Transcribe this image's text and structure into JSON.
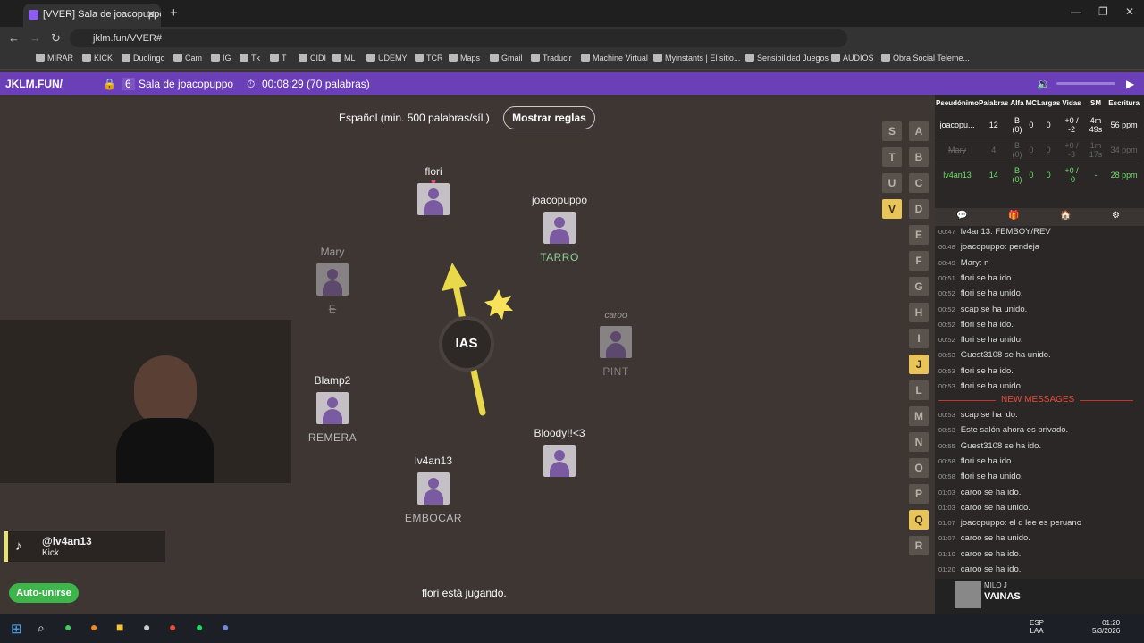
{
  "browser": {
    "tab_title": "[VVER] Sala de joacopuppo",
    "url": "jklm.fun/VVER#",
    "bookmarks": [
      "MIRAR",
      "KICK",
      "Duolingo",
      "Cam",
      "IG",
      "Tk",
      "T",
      "CIDI",
      "ML",
      "UDEMY",
      "TCR",
      "Maps",
      "Gmail",
      "Traducir",
      "Machine Virtual",
      "Myinstants | El sitio...",
      "Sensibilidad Juegos",
      "AUDIOS",
      "Obra Social Teleme..."
    ]
  },
  "header": {
    "site": "JKLM.FUN/",
    "count": "6",
    "room": "Sala de joacopuppo",
    "timer": "00:08:29 (70 palabras)"
  },
  "game": {
    "language": "Español (min. 500 palabras/síl.)",
    "rules_button": "Mostrar reglas",
    "syllable": "IAS",
    "status": "flori está jugando.",
    "autojoin": "Auto-unirse",
    "players": [
      {
        "name": "flori",
        "word": "",
        "hearts": "♥",
        "dead": false
      },
      {
        "name": "joacopuppo",
        "word": "TARRO",
        "hearts": "♥",
        "dead": false
      },
      {
        "name": "Mary",
        "word": "E",
        "hearts": "☠",
        "dead": true
      },
      {
        "name": "caroo",
        "word": "PINT",
        "hearts": "☠",
        "dead": true
      },
      {
        "name": "Blamp2",
        "word": "REMERA",
        "hearts": "♥♥",
        "dead": false
      },
      {
        "name": "Bloody!!<3",
        "word": "",
        "hearts": "☠",
        "dead": true
      },
      {
        "name": "lv4an13",
        "word": "EMBOCAR",
        "hearts": "♥♥♥",
        "dead": false
      }
    ],
    "letters_a": [
      "A",
      "B",
      "C",
      "D",
      "E",
      "F",
      "G",
      "H",
      "I",
      "J",
      "L",
      "M",
      "N",
      "O",
      "P",
      "Q",
      "R"
    ],
    "letters_s": [
      "S",
      "T",
      "U",
      "V"
    ],
    "letters_on": [
      "V",
      "J",
      "Q"
    ]
  },
  "overlay": {
    "handle": "@lv4an13",
    "platform": "Kick"
  },
  "scores": {
    "headers": [
      "Pseudónimo",
      "Palabras",
      "Alfa",
      "MC",
      "Largas",
      "Vidas",
      "SM",
      "Escritura"
    ],
    "rows": [
      [
        "joacopu...",
        "12",
        "B (0)",
        "0",
        "0",
        "+0 / -2",
        "4m 49s",
        "56 ppm"
      ],
      [
        "Mary",
        "4",
        "B (0)",
        "0",
        "0",
        "+0 / -3",
        "1m 17s",
        "34 ppm"
      ],
      [
        "lv4an13",
        "14",
        "B (0)",
        "0",
        "0",
        "+0 / -0",
        "-",
        "28 ppm"
      ]
    ]
  },
  "chat": {
    "messages": [
      {
        "t": "00:47",
        "text": "lv4an13: FEMBOY/REV"
      },
      {
        "t": "00:48",
        "text": "joacopuppo: pendeja"
      },
      {
        "t": "00:49",
        "text": "Mary: n"
      },
      {
        "t": "00:51",
        "text": "flori se ha ido."
      },
      {
        "t": "00:52",
        "text": "flori se ha unido."
      },
      {
        "t": "00:52",
        "text": "scap se ha unido."
      },
      {
        "t": "00:52",
        "text": "flori se ha ido."
      },
      {
        "t": "00:52",
        "text": "flori se ha unido."
      },
      {
        "t": "00:53",
        "text": "Guest3108 se ha unido."
      },
      {
        "t": "00:53",
        "text": "flori se ha ido."
      },
      {
        "t": "00:53",
        "text": "flori se ha unido."
      }
    ],
    "divider": "NEW MESSAGES",
    "new_messages": [
      {
        "t": "00:53",
        "text": "scap se ha ido."
      },
      {
        "t": "00:53",
        "text": "Este salón ahora es privado."
      },
      {
        "t": "00:55",
        "text": "Guest3108 se ha ido."
      },
      {
        "t": "00:58",
        "text": "flori se ha ido."
      },
      {
        "t": "00:58",
        "text": "flori se ha unido."
      },
      {
        "t": "01:03",
        "text": "caroo se ha ido."
      },
      {
        "t": "01:03",
        "text": "caroo se ha unido."
      },
      {
        "t": "01:07",
        "text": "joacopuppo: el q lee es peruano"
      },
      {
        "t": "01:07",
        "text": "caroo se ha unido."
      },
      {
        "t": "01:10",
        "text": "caroo se ha ido."
      },
      {
        "t": "01:20",
        "text": "caroo se ha ido."
      }
    ],
    "music_artist": "MILO J",
    "music_title": "VAINAS"
  },
  "taskbar": {
    "lang": "ESP",
    "layout": "LAA",
    "time": "01:20",
    "date": "5/3/2026"
  }
}
